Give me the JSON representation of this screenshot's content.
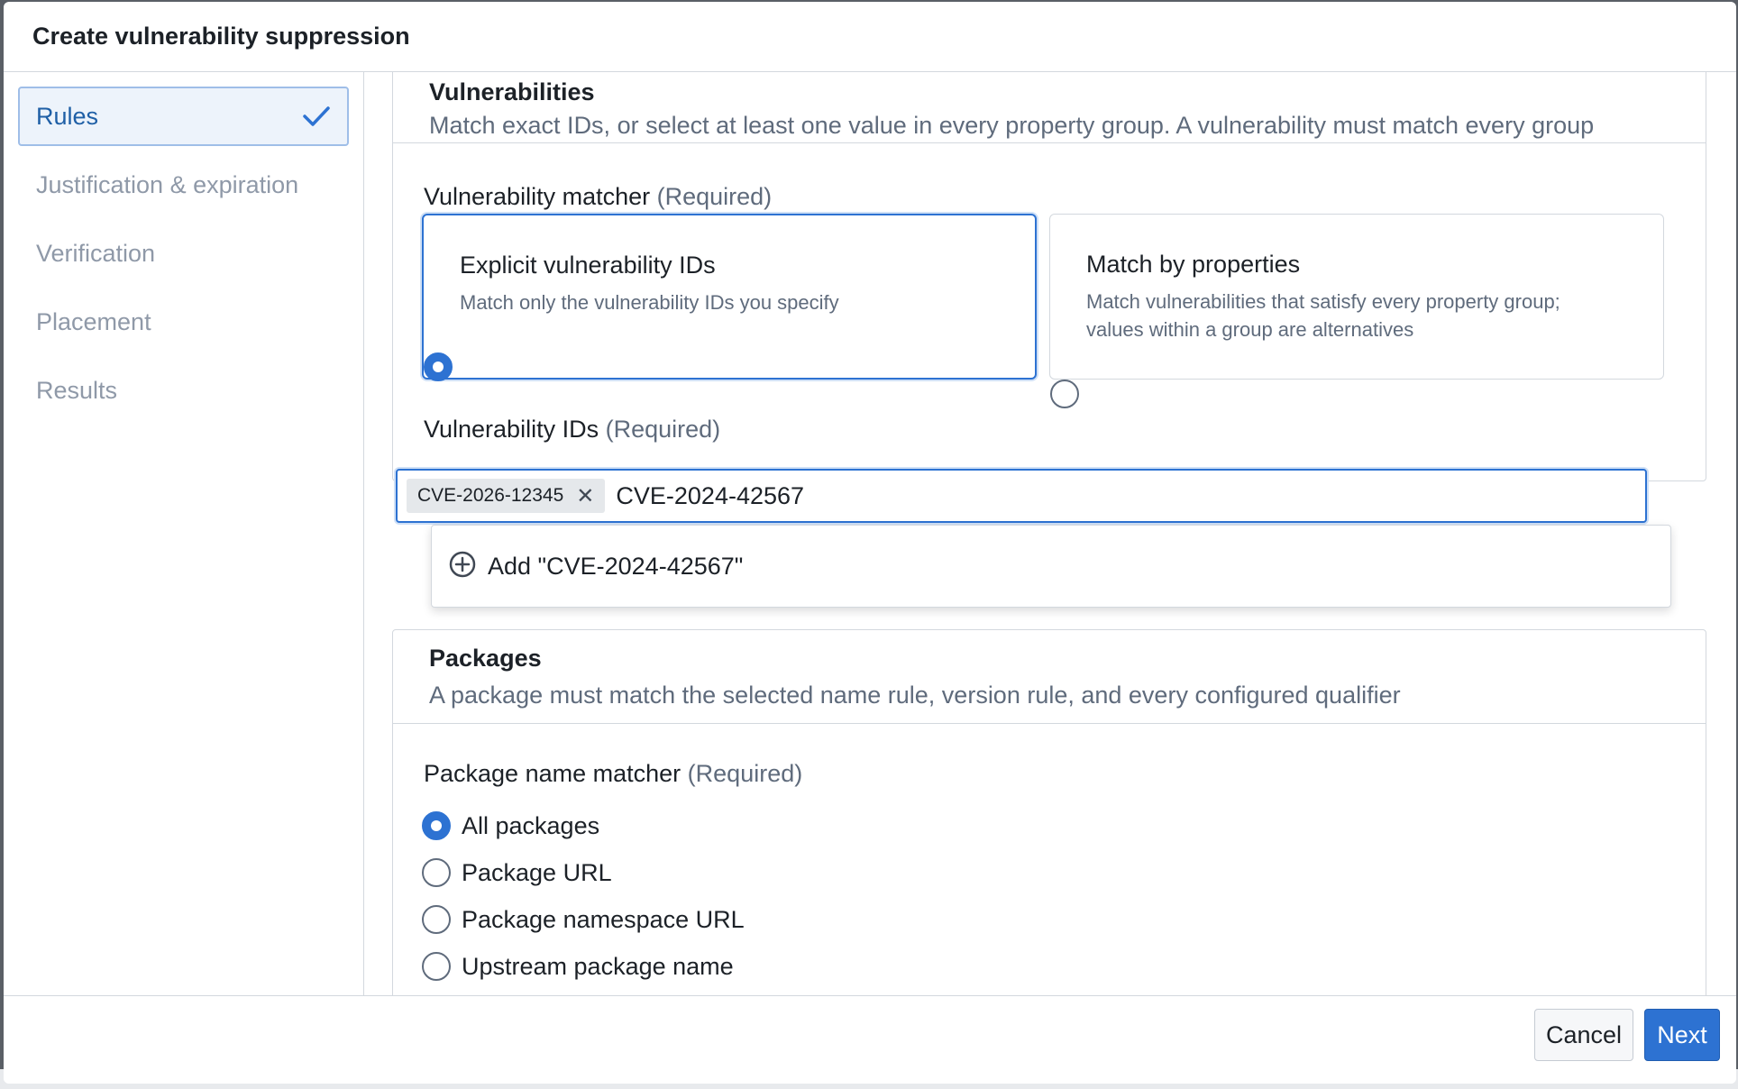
{
  "dialog": {
    "title": "Create vulnerability suppression"
  },
  "steps": [
    {
      "label": "Rules",
      "state": "complete-active"
    },
    {
      "label": "Justification & expiration",
      "state": "pending"
    },
    {
      "label": "Verification",
      "state": "pending"
    },
    {
      "label": "Placement",
      "state": "pending"
    },
    {
      "label": "Results",
      "state": "pending"
    }
  ],
  "vulnerabilities": {
    "title": "Vulnerabilities",
    "description": "Match exact IDs, or select at least one value in every property group. A vulnerability must match every group",
    "matcher_label": "Vulnerability matcher",
    "required_text": "(Required)",
    "options": [
      {
        "title": "Explicit vulnerability IDs",
        "description": "Match only the vulnerability IDs you specify",
        "selected": true
      },
      {
        "title": "Match by properties",
        "description_line1": "Match vulnerabilities that satisfy every property group;",
        "description_line2": "values within a group are alternatives",
        "selected": false
      }
    ],
    "ids_label": "Vulnerability IDs",
    "ids_required_text": "(Required)",
    "tags": [
      "CVE-2026-12345"
    ],
    "tag_remove_glyph": "✕",
    "input_value": "CVE-2024-42567",
    "suggestion": "Add \"CVE-2024-42567\""
  },
  "packages": {
    "title": "Packages",
    "description": "A package must match the selected name rule, version rule, and every configured qualifier",
    "matcher_label": "Package name matcher",
    "required_text": "(Required)",
    "options": [
      {
        "label": "All packages",
        "selected": true
      },
      {
        "label": "Package URL",
        "selected": false
      },
      {
        "label": "Package namespace URL",
        "selected": false
      },
      {
        "label": "Upstream package name",
        "selected": false
      }
    ]
  },
  "footer": {
    "cancel_label": "Cancel",
    "next_label": "Next"
  },
  "colors": {
    "accent": "#2d72d2",
    "muted_text": "#5f6b7c",
    "border": "#d3d8de"
  }
}
